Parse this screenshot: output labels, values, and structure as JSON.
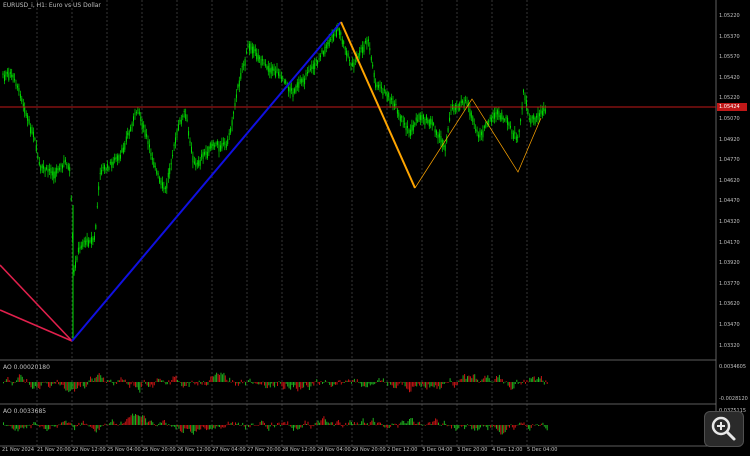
{
  "symbol_title": "EURUSD_i, H1:  Euro vs US Dollar",
  "current_price": "1.05424",
  "indicators": [
    {
      "title": "AO 0.00020180",
      "top_value": "0.0034605",
      "bottom_value": "-0.0028120"
    },
    {
      "title": "AO 0.0033685",
      "top_value": "0.0375115"
    }
  ],
  "y_axis_labels": [
    "1.05220",
    "1.05370",
    "1.05570",
    "1.05420",
    "1.05220",
    "1.05070",
    "1.04920",
    "1.04770",
    "1.04620",
    "1.04470",
    "1.04320",
    "1.04170",
    "1.03920",
    "1.03770",
    "1.03620",
    "1.03470",
    "1.03320"
  ],
  "x_axis_labels": [
    "21 Nov 2024",
    "21 Nov 20:00",
    "22 Nov 12:00",
    "25 Nov 04:00",
    "25 Nov 20:00",
    "26 Nov 12:00",
    "27 Nov 04:00",
    "27 Nov 20:00",
    "28 Nov 12:00",
    "29 Nov 04:00",
    "29 Nov 20:00",
    "2 Dec 12:00",
    "3 Dec 04:00",
    "3 Dec 20:00",
    "4 Dec 12:00",
    "5 Dec 04:00"
  ],
  "colors": {
    "background": "#000000",
    "candles": "#00e000",
    "price_line": "#c01818",
    "up_leg": "#1010e0",
    "down_leg": "#ffa500",
    "left_lines": "#e0204c",
    "grid": "#5a5a5a",
    "ao_up": "#1eb01e",
    "ao_down": "#c81414"
  },
  "zoom_icon": "magnifier-zoom-icon"
}
